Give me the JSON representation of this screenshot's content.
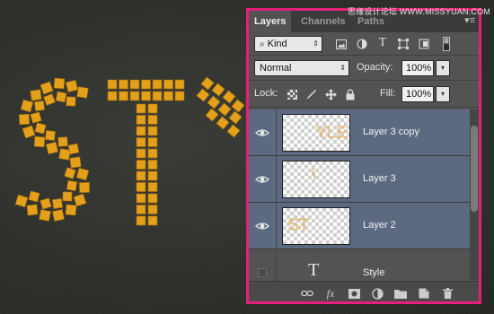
{
  "watermark": "思缘设计论坛 WWW.MISSYUAN.COM",
  "canvas_text": "STY",
  "colors": {
    "accent": "#e61f78",
    "text_fill": "#e3a01b",
    "selection": "#5b6a80"
  },
  "panel": {
    "tabs": [
      {
        "label": "Layers",
        "active": true
      },
      {
        "label": "Channels",
        "active": false
      },
      {
        "label": "Paths",
        "active": false
      }
    ],
    "filter": {
      "kind_label": "Kind",
      "icons": [
        "image-filter-icon",
        "adjustment-filter-icon",
        "type-filter-icon",
        "shape-filter-icon",
        "smart-object-filter-icon",
        "filter-toggle-icon"
      ]
    },
    "blend_mode": "Normal",
    "opacity_label": "Opacity:",
    "opacity_value": "100%",
    "lock_label": "Lock:",
    "fill_label": "Fill:",
    "fill_value": "100%",
    "layers": [
      {
        "name": "Layer 3 copy",
        "visible": true,
        "selected": true,
        "thumb_text": "YLE"
      },
      {
        "name": "Layer 3",
        "visible": true,
        "selected": true,
        "thumb_text": "\\"
      },
      {
        "name": "Layer 2",
        "visible": true,
        "selected": true,
        "thumb_text": "ST"
      },
      {
        "name": "Style",
        "visible": false,
        "selected": false,
        "type": "text"
      }
    ],
    "footer_icons": [
      "link-icon",
      "fx-icon",
      "mask-icon",
      "adjustment-icon",
      "folder-icon",
      "new-layer-icon",
      "trash-icon"
    ]
  }
}
